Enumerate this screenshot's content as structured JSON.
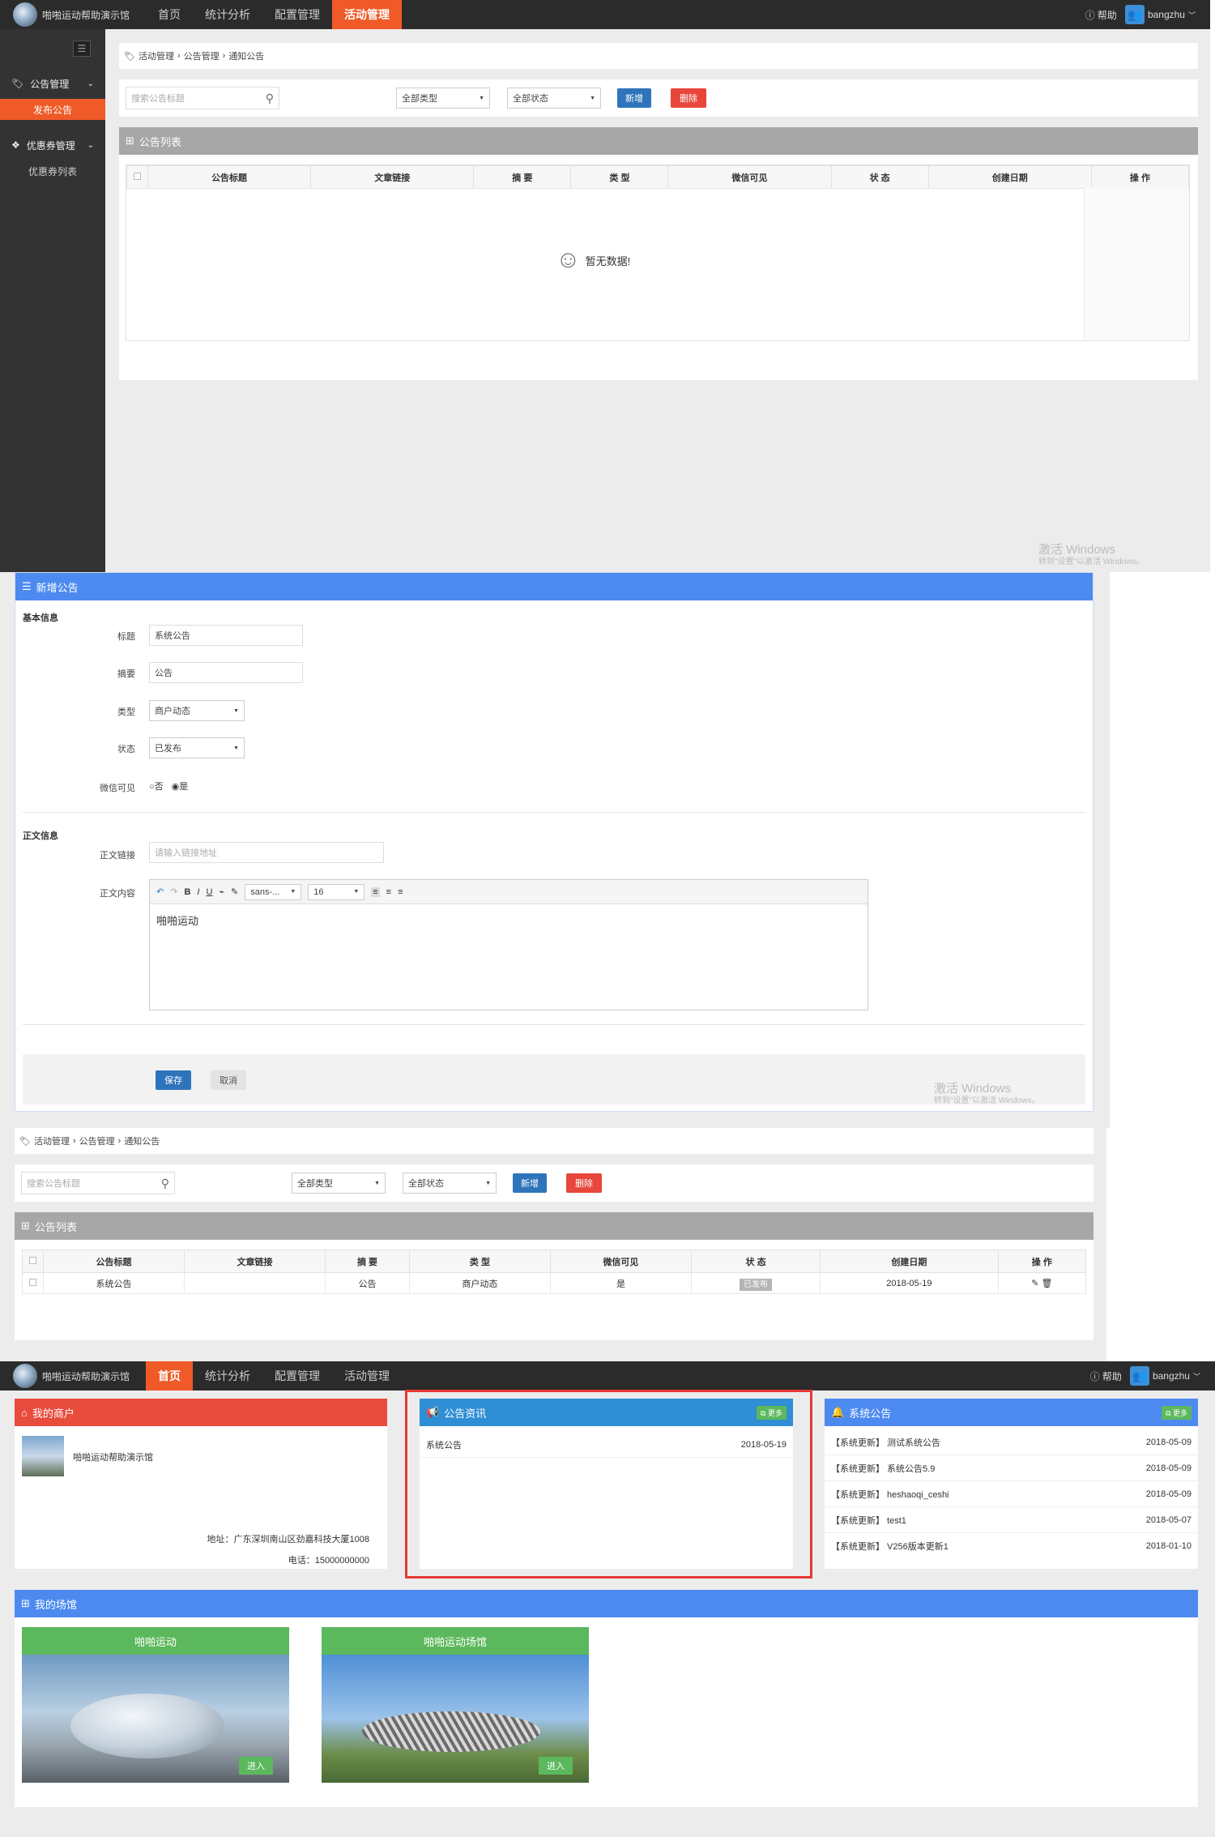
{
  "app": {
    "logo_text": "啪啪运动帮助演示馆",
    "help": "帮助",
    "user": "bangzhu",
    "user_caret": "﹀"
  },
  "nav": {
    "home": "首页",
    "stats": "统计分析",
    "config": "配置管理",
    "activity": "活动管理"
  },
  "sidebar": {
    "group1": "公告管理",
    "group1_sub": "发布公告",
    "group2": "优惠券管理",
    "group2_sub": "优惠券列表"
  },
  "breadcrumb": {
    "l1": "活动管理",
    "l2": "公告管理",
    "l3": "通知公告",
    "sep": "›"
  },
  "toolbar": {
    "search_placeholder": "搜索公告标题",
    "type_select": "全部类型",
    "status_select": "全部状态",
    "add": "新增",
    "delete": "删除"
  },
  "list": {
    "title": "公告列表",
    "headers": [
      "公告标题",
      "文章链接",
      "摘 要",
      "类 型",
      "微信可见",
      "状 态",
      "创建日期",
      "操 作"
    ],
    "empty_text": "暂无数据!",
    "row": {
      "title": "系统公告",
      "link": "",
      "summary": "公告",
      "type": "商户动态",
      "wechat": "是",
      "status": "已发布",
      "date": "2018-05-19"
    }
  },
  "form": {
    "title": "新增公告",
    "basic_section": "基本信息",
    "title_label": "标题",
    "title_value": "系统公告",
    "summary_label": "摘要",
    "summary_value": "公告",
    "type_label": "类型",
    "type_value": "商户动态",
    "status_label": "状态",
    "status_value": "已发布",
    "wechat_label": "微信可见",
    "wechat_no": "否",
    "wechat_yes": "是",
    "content_section": "正文信息",
    "link_label": "正文链接",
    "link_placeholder": "请输入链接地址",
    "content_label": "正文内容",
    "font_family": "sans-...",
    "font_size": "16",
    "content_text": "啪啪运动",
    "save": "保存",
    "cancel": "取消"
  },
  "watermark": {
    "title": "激活 Windows",
    "sub": "转到\"设置\"以激活 Windows。"
  },
  "dashboard": {
    "merchant": {
      "title": "我的商户",
      "name": "啪啪运动帮助演示馆",
      "address": "地址：广东深圳南山区劲嘉科技大厦1008",
      "phone": "电话：15000000000"
    },
    "news": {
      "title": "公告资讯",
      "more": "更多",
      "items": [
        {
          "title": "系统公告",
          "date": "2018-05-19"
        }
      ]
    },
    "sys": {
      "title": "系统公告",
      "more": "更多",
      "items": [
        {
          "title": "【系统更新】 测试系统公告",
          "date": "2018-05-09"
        },
        {
          "title": "【系统更新】 系统公告5.9",
          "date": "2018-05-09"
        },
        {
          "title": "【系统更新】 heshaoqi_ceshi",
          "date": "2018-05-09"
        },
        {
          "title": "【系统更新】 test1",
          "date": "2018-05-07"
        },
        {
          "title": "【系统更新】 V256版本更新1",
          "date": "2018-01-10"
        }
      ]
    },
    "venues": {
      "title": "我的场馆",
      "items": [
        {
          "name": "啪啪运动",
          "enter": "进入"
        },
        {
          "name": "啪啪运动场馆",
          "enter": "进入"
        }
      ]
    }
  },
  "colors": {
    "accent": "#f05a28",
    "blue": "#2e74bb",
    "red": "#e8463b",
    "green": "#5cb85c",
    "highlight": "#e53935"
  }
}
